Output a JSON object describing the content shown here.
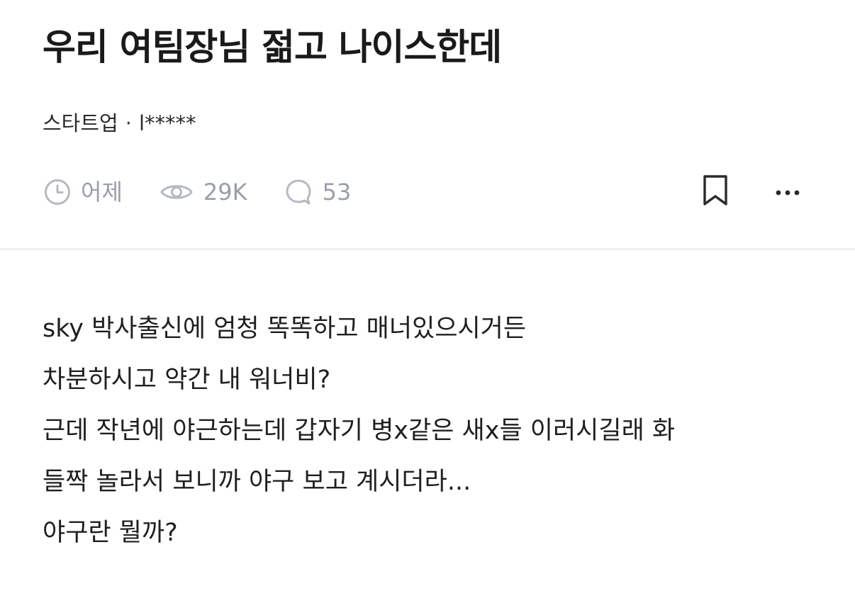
{
  "post": {
    "title": "우리 여팀장님 젊고 나이스한데",
    "category": "스타트업",
    "separator": "·",
    "author": "l*****"
  },
  "stats": {
    "time": {
      "icon": "clock-icon",
      "label": "어제"
    },
    "views": {
      "icon": "eye-icon",
      "label": "29K"
    },
    "comments": {
      "icon": "comment-icon",
      "label": "53"
    }
  },
  "actions": {
    "bookmark_icon": "bookmark-icon",
    "more_icon": "more-icon"
  },
  "body": {
    "lines": [
      "sky 박사출신에 엄청 똑똑하고 매너있으시거든",
      "차분하시고 약간 내 워너비?",
      "근데 작년에 야근하는데 갑자기 병x같은 새x들 이러시길래 화",
      "들짝 놀라서 보니까 야구 보고 계시더라...",
      "야구란 뭘까?"
    ]
  },
  "colors": {
    "text": "#1f1f1f",
    "muted": "#9a9ea7",
    "icon": "#b5b9c2",
    "divider": "#eeeef0"
  }
}
